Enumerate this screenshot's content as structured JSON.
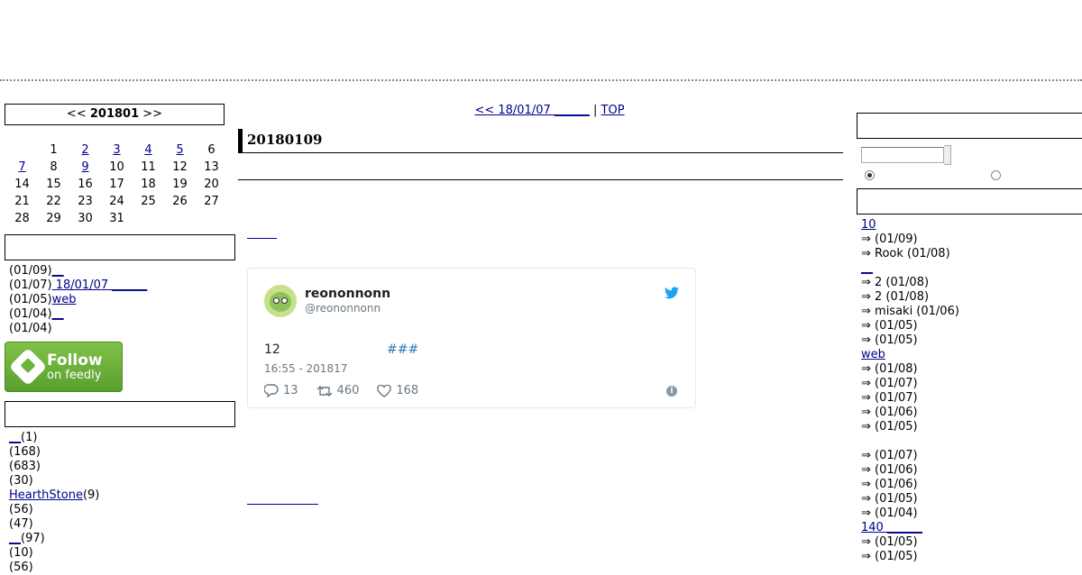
{
  "calendar": {
    "prev": "<<",
    "month": "201801",
    "next": ">>",
    "weeks": [
      [
        {
          "d": ""
        },
        {
          "d": "1"
        },
        {
          "d": "2",
          "link": true
        },
        {
          "d": "3",
          "link": true
        },
        {
          "d": "4",
          "link": true
        },
        {
          "d": "5",
          "link": true
        },
        {
          "d": "6"
        }
      ],
      [
        {
          "d": "7",
          "link": true
        },
        {
          "d": "8"
        },
        {
          "d": "9",
          "link": true
        },
        {
          "d": "10"
        },
        {
          "d": "11"
        },
        {
          "d": "12"
        },
        {
          "d": "13"
        }
      ],
      [
        {
          "d": "14"
        },
        {
          "d": "15"
        },
        {
          "d": "16"
        },
        {
          "d": "17"
        },
        {
          "d": "18"
        },
        {
          "d": "19"
        },
        {
          "d": "20"
        }
      ],
      [
        {
          "d": "21"
        },
        {
          "d": "22"
        },
        {
          "d": "23"
        },
        {
          "d": "24"
        },
        {
          "d": "25"
        },
        {
          "d": "26"
        },
        {
          "d": "27"
        }
      ],
      [
        {
          "d": "28"
        },
        {
          "d": "29"
        },
        {
          "d": "30"
        },
        {
          "d": "31"
        },
        {
          "d": ""
        },
        {
          "d": ""
        },
        {
          "d": ""
        }
      ]
    ]
  },
  "recent_entries": [
    {
      "date": "(01/09)",
      "link": "__"
    },
    {
      "date": "(01/07)",
      "link": " 18/01/07 ______"
    },
    {
      "date": "(01/05)",
      "link": "web"
    },
    {
      "date": "(01/04)",
      "link": "__"
    },
    {
      "date": "(01/04)",
      "link": ""
    }
  ],
  "feedly": {
    "line1": "Follow",
    "line2": "on feedly"
  },
  "categories": [
    {
      "link": "__",
      "count": "(1)"
    },
    {
      "link": "",
      "count": "(168)"
    },
    {
      "link": "",
      "count": "(683)"
    },
    {
      "link": "",
      "count": "(30)"
    },
    {
      "link": "HearthStone",
      "count": "(9)"
    },
    {
      "link": "",
      "count": "(56)"
    },
    {
      "link": "",
      "count": "(47)"
    },
    {
      "link": "__",
      "count": "(97)"
    },
    {
      "link": "",
      "count": "(10)"
    },
    {
      "link": "",
      "count": "(56)"
    }
  ],
  "nav": {
    "prev": "<<  18/01/07 ______",
    "sep": " | ",
    "top": "TOP"
  },
  "entry": {
    "title": "20180109"
  },
  "tweet": {
    "name": "reononnonn",
    "handle": "@reononnonn",
    "body": "12",
    "hashtag": "###",
    "time": "16:55 - 201817",
    "replies": "13",
    "retweets": "460",
    "likes": "168"
  },
  "right": {
    "comments": [
      {
        "type": "link",
        "text": "10"
      },
      {
        "type": "text",
        "text": "⇒  (01/09)"
      },
      {
        "type": "text",
        "text": "⇒ Rook (01/08)"
      },
      {
        "type": "link",
        "text": "__"
      },
      {
        "type": "text",
        "text": "⇒ 2 (01/08)"
      },
      {
        "type": "text",
        "text": "⇒ 2 (01/08)"
      },
      {
        "type": "text",
        "text": "⇒ misaki (01/06)"
      },
      {
        "type": "text",
        "text": "⇒  (01/05)"
      },
      {
        "type": "text",
        "text": "⇒  (01/05)"
      },
      {
        "type": "link",
        "text": "web"
      },
      {
        "type": "text",
        "text": "⇒  (01/08)"
      },
      {
        "type": "text",
        "text": "⇒  (01/07)"
      },
      {
        "type": "text",
        "text": "⇒  (01/07)"
      },
      {
        "type": "text",
        "text": "⇒ (01/06)"
      },
      {
        "type": "text",
        "text": "⇒  (01/05)"
      },
      {
        "type": "text",
        "text": ""
      },
      {
        "type": "text",
        "text": "⇒  (01/07)"
      },
      {
        "type": "text",
        "text": "⇒  (01/06)"
      },
      {
        "type": "text",
        "text": "⇒  (01/06)"
      },
      {
        "type": "text",
        "text": "⇒  (01/05)"
      },
      {
        "type": "text",
        "text": "⇒  (01/04)"
      },
      {
        "type": "link",
        "text": " 140 ______"
      },
      {
        "type": "text",
        "text": "⇒  (01/05)"
      },
      {
        "type": "text",
        "text": "⇒  (01/05)"
      }
    ]
  }
}
